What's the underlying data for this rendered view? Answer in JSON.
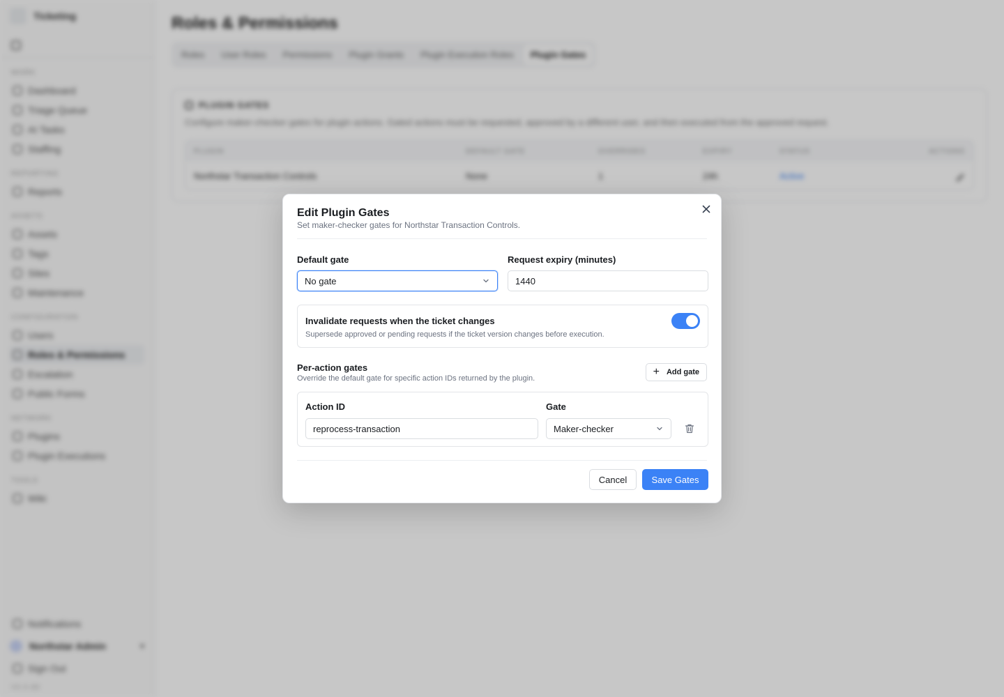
{
  "app": {
    "brand": "Ticketing",
    "page_title": "Roles & Permissions",
    "tabs": [
      "Roles",
      "User Roles",
      "Permissions",
      "Plugin Grants",
      "Plugin Execution Roles",
      "Plugin Gates"
    ],
    "active_tab": "Plugin Gates"
  },
  "sidebar": {
    "sections": [
      {
        "title": "WORK",
        "items": [
          "Dashboard",
          "Triage Queue",
          "AI Tasks",
          "Staffing"
        ]
      },
      {
        "title": "REPORTING",
        "items": [
          "Reports"
        ]
      },
      {
        "title": "ASSETS",
        "items": [
          "Assets",
          "Tags",
          "Sites",
          "Maintenance"
        ]
      },
      {
        "title": "CONFIGURATION",
        "items": [
          "Users",
          "Roles & Permissions",
          "Escalation",
          "Public Forms"
        ]
      },
      {
        "title": "NETWORK",
        "items": [
          "Plugins",
          "Plugin Executions"
        ]
      },
      {
        "title": "TOOLS",
        "items": [
          "Wiki"
        ]
      }
    ],
    "active_item": "Roles & Permissions",
    "bottom": {
      "notifications": "Notifications",
      "user_name": "Northstar Admin",
      "sign_out": "Sign Out",
      "version": "V0.0.88"
    }
  },
  "panel": {
    "heading": "PLUGIN GATES",
    "description": "Configure maker-checker gates for plugin actions. Gated actions must be requested, approved by a different user, and then executed from the approved request.",
    "columns": [
      "PLUGIN",
      "DEFAULT GATE",
      "OVERRIDES",
      "EXPIRY",
      "STATUS",
      "ACTIONS"
    ],
    "rows": [
      {
        "plugin": "Northstar Transaction Controls",
        "default_gate": "None",
        "overrides": "1",
        "expiry": "24h",
        "status": "Active"
      }
    ]
  },
  "modal": {
    "title": "Edit Plugin Gates",
    "subtitle": "Set maker-checker gates for Northstar Transaction Controls.",
    "default_gate": {
      "label": "Default gate",
      "value": "No gate"
    },
    "request_expiry": {
      "label": "Request expiry (minutes)",
      "value": "1440"
    },
    "invalidate": {
      "title": "Invalidate requests when the ticket changes",
      "description": "Supersede approved or pending requests if the ticket version changes before execution.",
      "enabled": true
    },
    "per_action": {
      "title": "Per-action gates",
      "description": "Override the default gate for specific action IDs returned by the plugin.",
      "add_label": "Add gate",
      "action_id_label": "Action ID",
      "gate_label": "Gate",
      "rows": [
        {
          "action_id": "reprocess-transaction",
          "gate": "Maker-checker"
        }
      ]
    },
    "cancel_label": "Cancel",
    "save_label": "Save Gates"
  },
  "colors": {
    "accent": "#3b82f6",
    "overlay": "rgba(0,0,0,0.22)"
  }
}
